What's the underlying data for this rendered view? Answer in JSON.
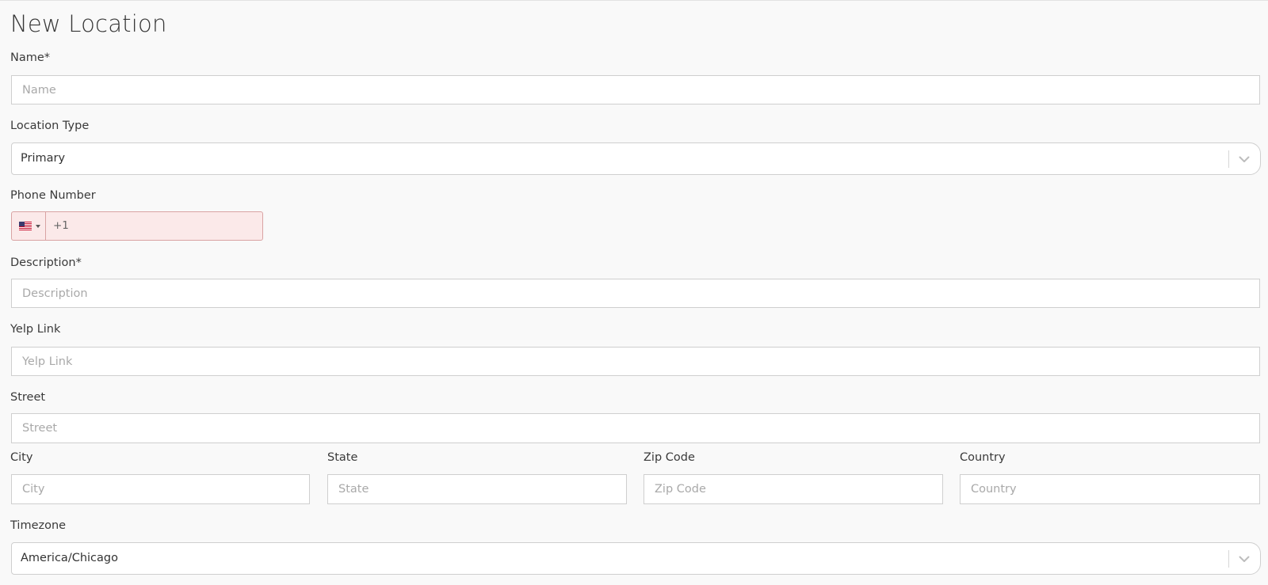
{
  "page": {
    "title": "New Location"
  },
  "form": {
    "name": {
      "label": "Name*",
      "placeholder": "Name"
    },
    "location_type": {
      "label": "Location Type",
      "value": "Primary"
    },
    "phone": {
      "label": "Phone Number",
      "dial_code": "+1",
      "country_flag": "us-flag-icon"
    },
    "description": {
      "label": "Description*",
      "placeholder": "Description"
    },
    "yelp": {
      "label": "Yelp Link",
      "placeholder": "Yelp Link"
    },
    "street": {
      "label": "Street",
      "placeholder": "Street"
    },
    "city": {
      "label": "City",
      "placeholder": "City"
    },
    "state": {
      "label": "State",
      "placeholder": "State"
    },
    "zip": {
      "label": "Zip Code",
      "placeholder": "Zip Code"
    },
    "country": {
      "label": "Country",
      "placeholder": "Country"
    },
    "timezone": {
      "label": "Timezone",
      "value": "America/Chicago"
    }
  },
  "colors": {
    "background": "#f9f9f9",
    "input_border": "#cfcfcf",
    "phone_error_bg": "#fbe9e9",
    "phone_error_border": "#d9a3a3"
  }
}
